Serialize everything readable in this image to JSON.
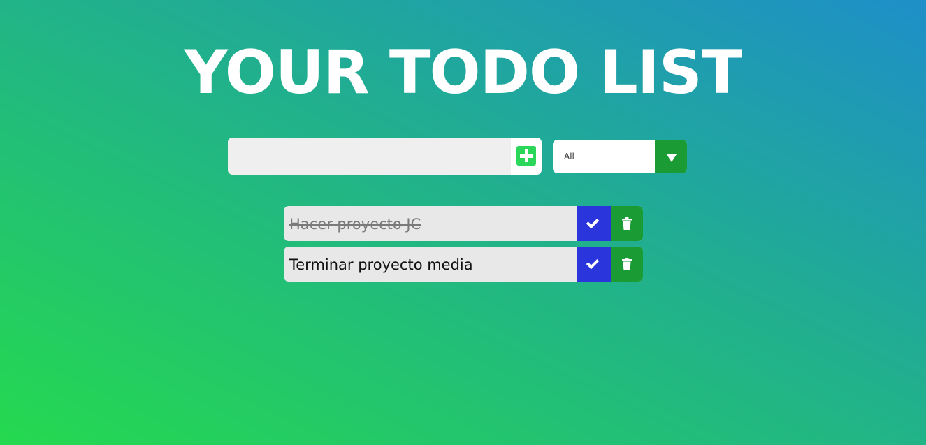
{
  "header": {
    "title": "YOUR TODO LIST"
  },
  "add_form": {
    "input_value": "",
    "input_placeholder": "",
    "add_icon": "plus-square-icon"
  },
  "filter": {
    "selected": "All",
    "arrow_icon": "chevron-down-icon"
  },
  "todos": [
    {
      "text": "Hacer proyecto JC",
      "completed": true
    },
    {
      "text": "Terminar proyecto media",
      "completed": false
    }
  ],
  "colors": {
    "gradient_start": "#25d94f",
    "gradient_end": "#1e8fc8",
    "complete_button": "#2a35db",
    "delete_button": "#1a9b34",
    "add_icon": "#2bd75a"
  }
}
